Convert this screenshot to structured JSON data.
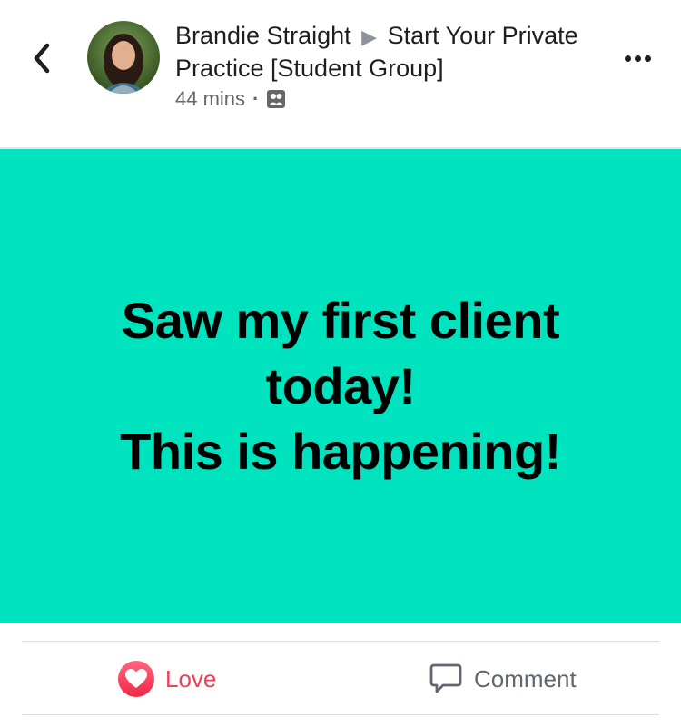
{
  "header": {
    "author": "Brandie Straight",
    "separator_icon": "triangle-right-icon",
    "group": "Start Your Private Practice [Student Group]",
    "time": "44 mins",
    "audience_icon": "group-audience-icon",
    "back_icon": "chevron-left-icon",
    "more_icon": "more-dots-icon"
  },
  "post": {
    "text": "Saw my first client today!\nThis is happening!",
    "background_color": "#00e3bf",
    "text_color": "#000000"
  },
  "actions": {
    "love_label": "Love",
    "love_color": "#f33e58",
    "comment_label": "Comment",
    "comment_color": "#606770"
  }
}
